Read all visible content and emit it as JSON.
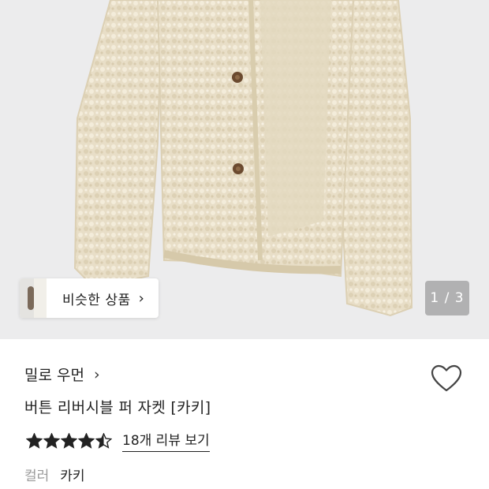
{
  "gallery": {
    "similar_label": "비슷한 상품",
    "similar_chevron": "›",
    "counter": "1 / 3"
  },
  "product": {
    "brand": "밀로 우먼",
    "brand_chevron": "›",
    "title": "버튼 리버시블 퍼 자켓 [카키]",
    "rating": 4.5,
    "review_link": "18개 리뷰 보기",
    "color_label": "컬러",
    "color_value": "카키"
  },
  "colors": {
    "background_image": "#ececed",
    "fur": "#e6dcc4",
    "star": "#222222",
    "accent_text": "#222222",
    "muted_text": "#9a9a9a"
  }
}
